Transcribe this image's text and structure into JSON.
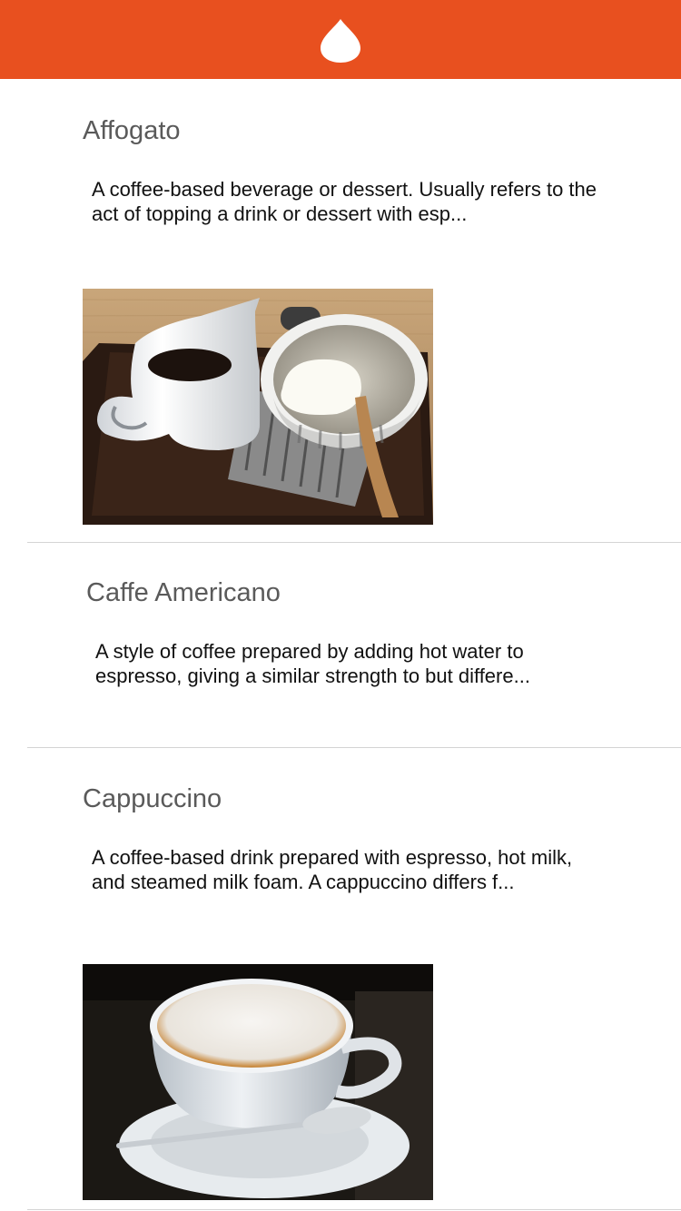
{
  "app": {
    "brand_color": "#e8501f",
    "logo_icon": "drop-icon"
  },
  "items": [
    {
      "title": "Affogato",
      "description": "A coffee-based beverage or dessert. Usually refers to the act of topping a drink or dessert with esp...",
      "image": "affogato-photo"
    },
    {
      "title": "Caffe Americano",
      "description": "A style of coffee prepared by adding hot water to espresso, giving a similar strength to but differe..."
    },
    {
      "title": "Cappuccino",
      "description": "A coffee-based drink prepared with espresso, hot milk, and steamed milk foam. A cappuccino differs f...",
      "image": "cappuccino-photo"
    }
  ]
}
